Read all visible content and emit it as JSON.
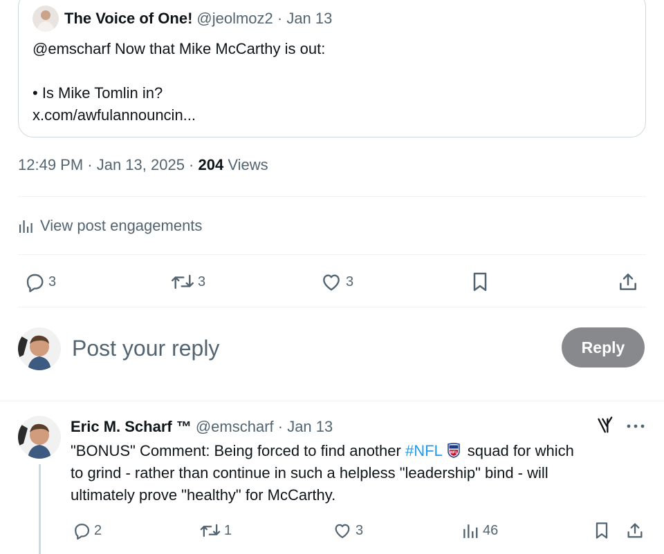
{
  "quoted_post": {
    "display_name": "The Voice of One!",
    "handle_date": "@jeolmoz2 · Jan 13",
    "lines": [
      "@emscharf Now that Mike McCarthy is out:",
      "",
      "• Is Mike Tomlin in?",
      "x.com/awfulannouncin..."
    ]
  },
  "post_meta": {
    "time_date": "12:49 PM · Jan 13, 2025 · ",
    "views_count": "204",
    "views_label": " Views"
  },
  "engagements_label": "View post engagements",
  "actions": {
    "replies": "3",
    "reposts": "3",
    "likes": "3"
  },
  "reply_box": {
    "placeholder": "Post your reply",
    "button_label": "Reply"
  },
  "comment": {
    "display_name": "Eric M. Scharf ™",
    "handle_date": "@emscharf · Jan 13",
    "line1_pre": "\"BONUS\" Comment: Being forced to find another ",
    "hashtag": "#NFL",
    "line1_post": "squad for which",
    "line2": "to grind - rather than continue in such a helpless \"leadership\" bind - will",
    "line3": "ultimately prove \"healthy\" for McCarthy.",
    "replies": "2",
    "reposts": "1",
    "likes": "3",
    "views": "46"
  },
  "icons": {
    "reply": "reply-icon",
    "repost": "repost-icon",
    "like": "heart-icon",
    "bookmark": "bookmark-icon",
    "share": "share-icon",
    "analytics": "analytics-icon",
    "grok": "grok-icon",
    "more": "more-icon"
  },
  "colors": {
    "text_primary": "#0f1419",
    "text_secondary": "#536471",
    "accent": "#1d9bf0",
    "reply_button": "#87898c",
    "border": "#cfd9de"
  }
}
